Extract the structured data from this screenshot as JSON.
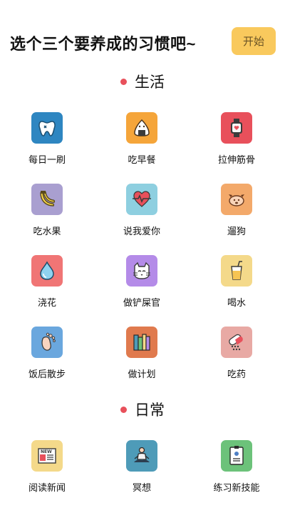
{
  "header": {
    "title": "选个三个要养成的习惯吧~",
    "start_label": "开始"
  },
  "sections": [
    {
      "title": "生活"
    },
    {
      "title": "日常"
    }
  ],
  "life": [
    {
      "label": "每日一刷",
      "icon": "tooth-icon",
      "color": "#2e86c1"
    },
    {
      "label": "吃早餐",
      "icon": "onigiri-icon",
      "color": "#f5a53a"
    },
    {
      "label": "拉伸筋骨",
      "icon": "smartwatch-icon",
      "color": "#e8505b"
    },
    {
      "label": "吃水果",
      "icon": "banana-icon",
      "color": "#a99fd0"
    },
    {
      "label": "说我爱你",
      "icon": "heartbeat-icon",
      "color": "#8ecfe0"
    },
    {
      "label": "遛狗",
      "icon": "dog-icon",
      "color": "#f3a96a"
    },
    {
      "label": "浇花",
      "icon": "water-drop-icon",
      "color": "#f07575"
    },
    {
      "label": "做铲屎官",
      "icon": "cat-icon",
      "color": "#b48be8"
    },
    {
      "label": "喝水",
      "icon": "drink-cup-icon",
      "color": "#f4d98a"
    },
    {
      "label": "饭后散步",
      "icon": "footprint-icon",
      "color": "#6aa7de"
    },
    {
      "label": "做计划",
      "icon": "books-icon",
      "color": "#e07a4e"
    },
    {
      "label": "吃药",
      "icon": "pills-icon",
      "color": "#e8a9a4"
    }
  ],
  "daily": [
    {
      "label": "阅读新闻",
      "icon": "newspaper-icon",
      "color": "#f4d98a",
      "text": "NEW"
    },
    {
      "label": "冥想",
      "icon": "meditation-icon",
      "color": "#4e9bb8"
    },
    {
      "label": "练习新技能",
      "icon": "skill-card-icon",
      "color": "#6cc27a"
    }
  ]
}
